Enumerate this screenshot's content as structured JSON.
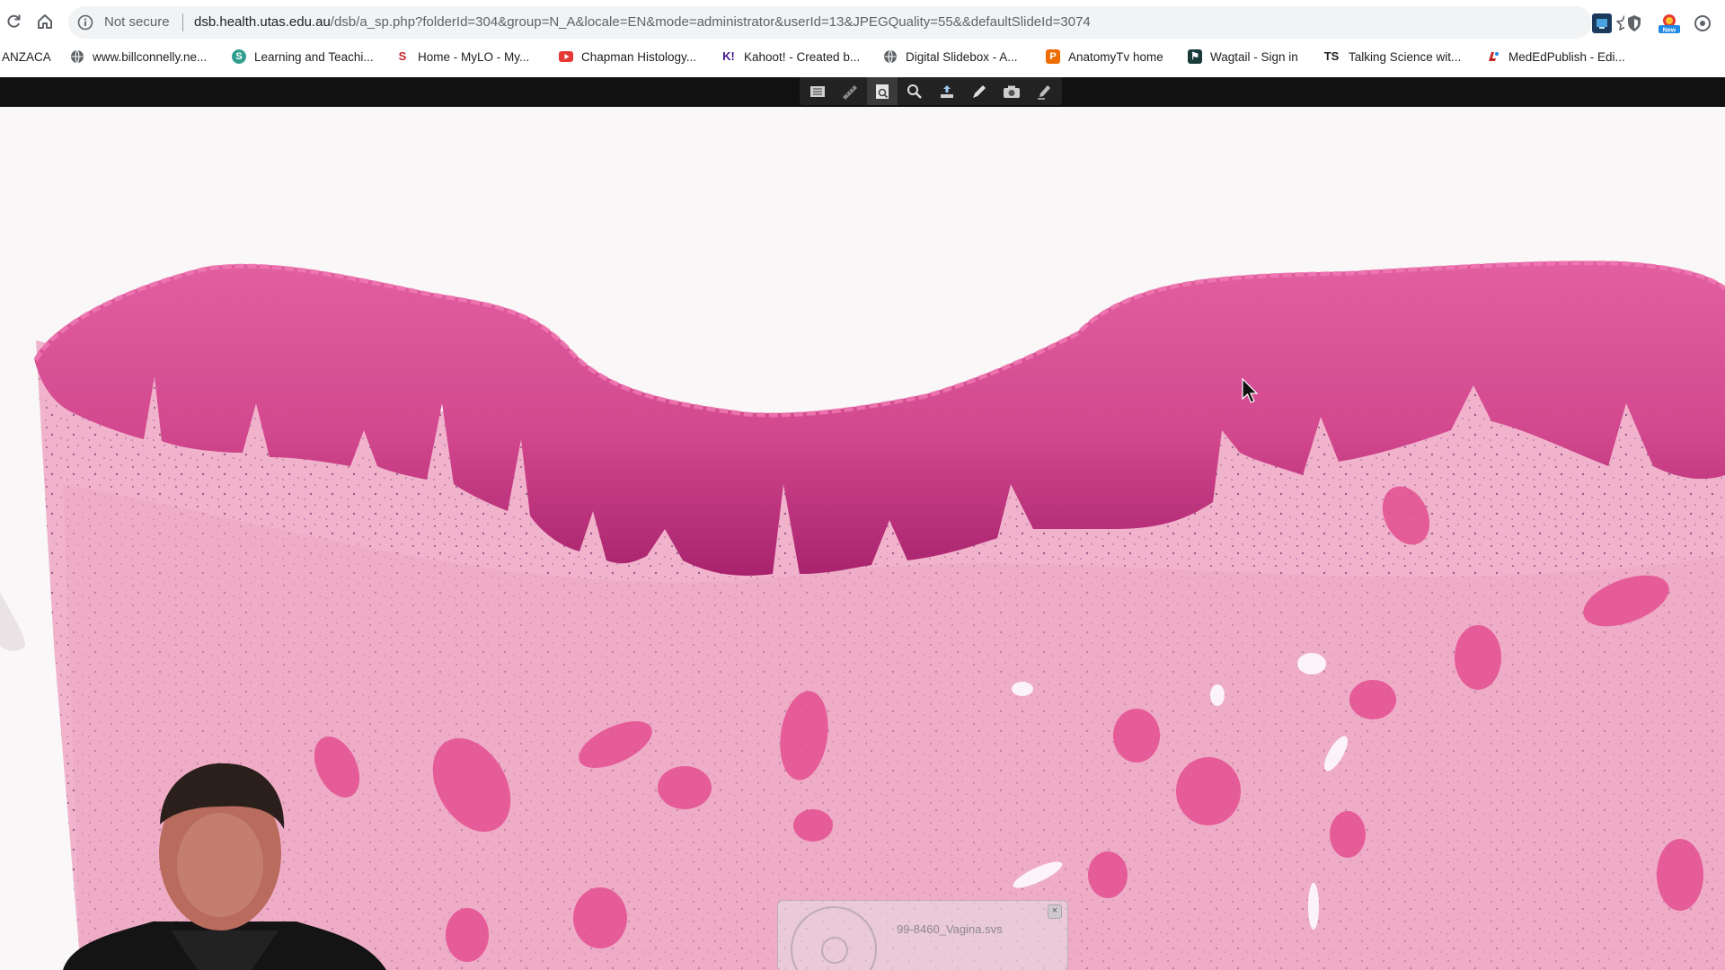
{
  "browser": {
    "security_label": "Not secure",
    "url_host": "dsb.health.utas.edu.au",
    "url_path": "/dsb/a_sp.php?folderId=304&group=N_A&locale=EN&mode=administrator&userId=13&JPEGQuality=55&&defaultSlideId=3074",
    "bookmarks": [
      {
        "label": "ANZACA",
        "icon": "none"
      },
      {
        "label": "www.billconnelly.ne...",
        "icon": "globe-icon"
      },
      {
        "label": "Learning and Teachi...",
        "icon": "teams-icon"
      },
      {
        "label": "Home - MyLO - My...",
        "icon": "mylo-icon"
      },
      {
        "label": "Chapman Histology...",
        "icon": "youtube-icon"
      },
      {
        "label": "Kahoot! - Created b...",
        "icon": "kahoot-icon"
      },
      {
        "label": "Digital Slidebox - A...",
        "icon": "globe-icon"
      },
      {
        "label": "AnatomyTv home",
        "icon": "anatomytv-icon"
      },
      {
        "label": "Wagtail - Sign in",
        "icon": "wagtail-icon"
      },
      {
        "label": "Talking Science wit...",
        "icon": "ts-icon"
      },
      {
        "label": "MedEdPublish - Edi...",
        "icon": "mededpublish-icon"
      }
    ]
  },
  "viewer": {
    "tools": [
      "slide-list",
      "ruler",
      "slide-info",
      "zoom",
      "upload",
      "annotate-pen",
      "screenshot",
      "edit-pencil"
    ],
    "active_tool": "slide-info",
    "thumbnail_label": "99-8460_Vagina.svs",
    "thumbnail_close": "×"
  }
}
